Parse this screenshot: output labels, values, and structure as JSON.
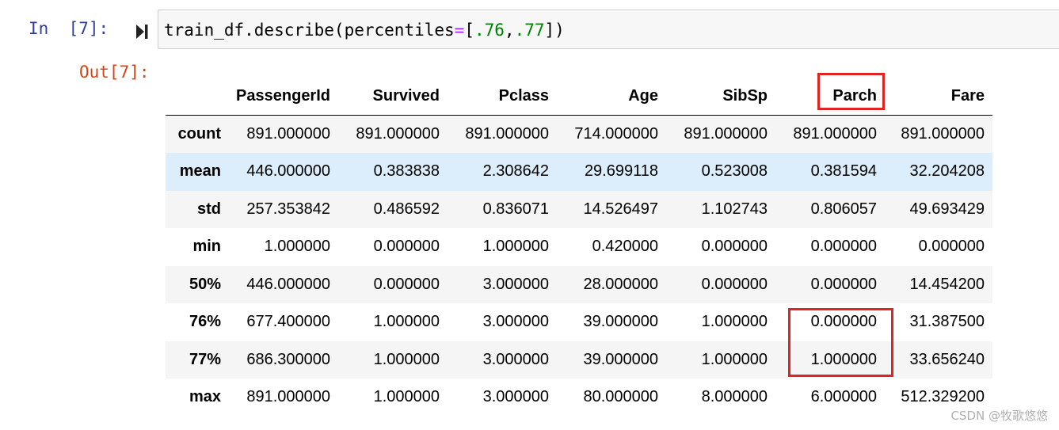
{
  "cell": {
    "in_prompt": "In  [7]:",
    "out_prompt": "Out[7]:",
    "code": {
      "prefix": "train_df.describe(percentiles",
      "op": "=",
      "open": "[",
      "num1": ".76",
      "comma": ",",
      "num2": ".77",
      "close": "])"
    }
  },
  "table": {
    "columns": [
      "",
      "PassengerId",
      "Survived",
      "Pclass",
      "Age",
      "SibSp",
      "Parch",
      "Fare"
    ],
    "rows": [
      {
        "label": "count",
        "values": [
          "891.000000",
          "891.000000",
          "891.000000",
          "714.000000",
          "891.000000",
          "891.000000",
          "891.000000"
        ]
      },
      {
        "label": "mean",
        "values": [
          "446.000000",
          "0.383838",
          "2.308642",
          "29.699118",
          "0.523008",
          "0.381594",
          "32.204208"
        ]
      },
      {
        "label": "std",
        "values": [
          "257.353842",
          "0.486592",
          "0.836071",
          "14.526497",
          "1.102743",
          "0.806057",
          "49.693429"
        ]
      },
      {
        "label": "min",
        "values": [
          "1.000000",
          "0.000000",
          "1.000000",
          "0.420000",
          "0.000000",
          "0.000000",
          "0.000000"
        ]
      },
      {
        "label": "50%",
        "values": [
          "446.000000",
          "0.000000",
          "3.000000",
          "28.000000",
          "0.000000",
          "0.000000",
          "14.454200"
        ]
      },
      {
        "label": "76%",
        "values": [
          "677.400000",
          "1.000000",
          "3.000000",
          "39.000000",
          "1.000000",
          "0.000000",
          "31.387500"
        ]
      },
      {
        "label": "77%",
        "values": [
          "686.300000",
          "1.000000",
          "3.000000",
          "39.000000",
          "1.000000",
          "1.000000",
          "33.656240"
        ]
      },
      {
        "label": "max",
        "values": [
          "891.000000",
          "1.000000",
          "3.000000",
          "80.000000",
          "8.000000",
          "6.000000",
          "512.329200"
        ]
      }
    ],
    "hovered_row_index": 1
  },
  "annotations": {
    "highlight_color": "#e02424"
  },
  "watermark": "CSDN @牧歌悠悠",
  "colors": {
    "prompt_in": "#303F9F",
    "prompt_out": "#D84315",
    "code_bg": "#f7f7f7",
    "row_stripe": "#f5f5f5",
    "row_hover": "#dceefb"
  },
  "icons": {
    "run": "step-forward-icon"
  }
}
